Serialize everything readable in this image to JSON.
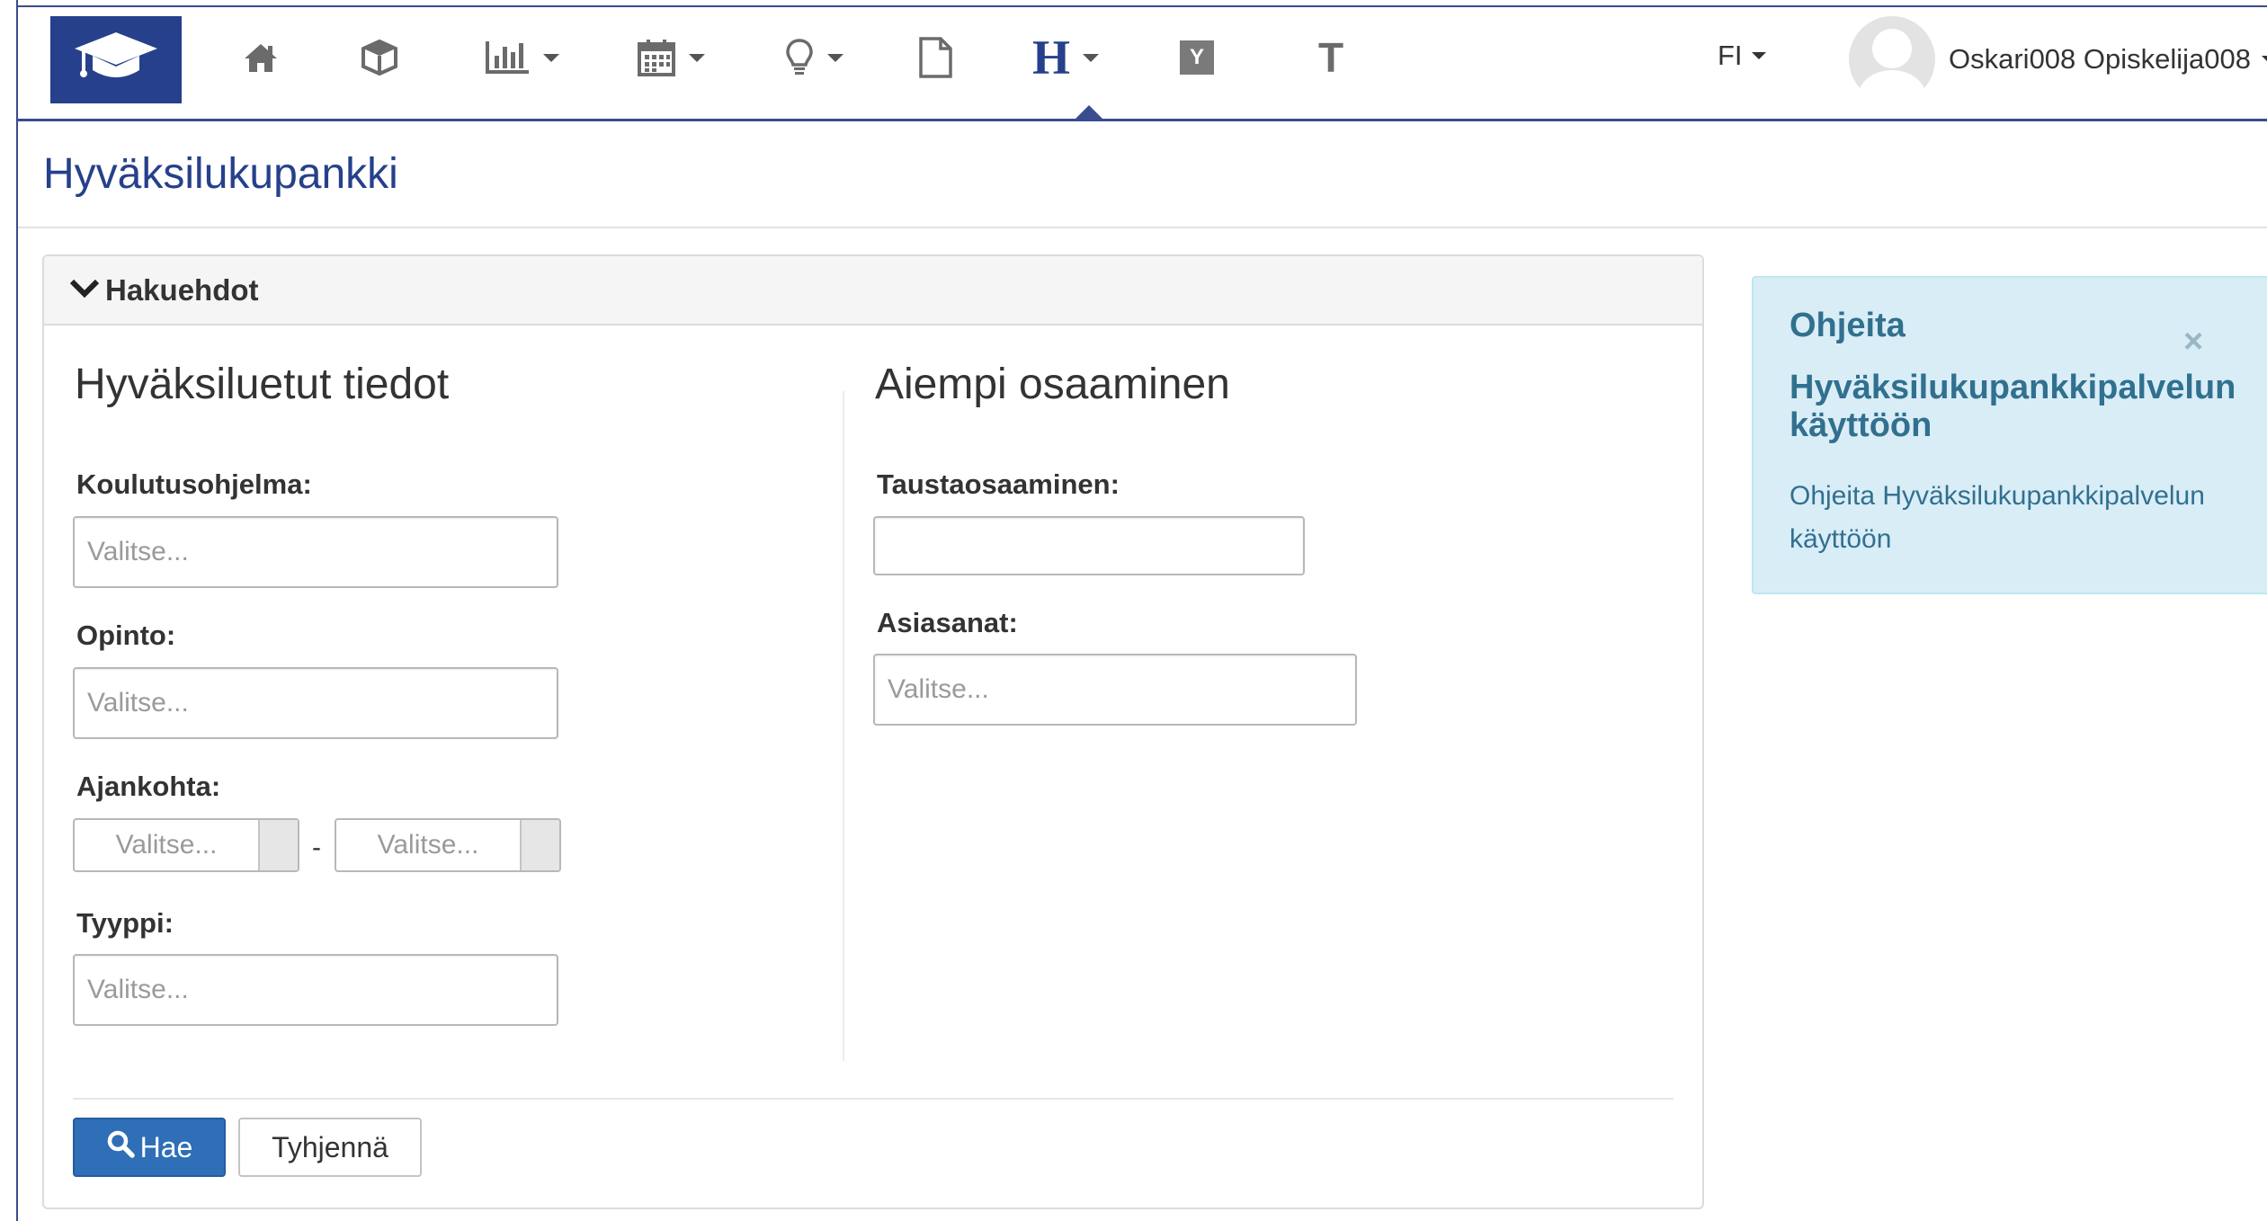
{
  "nav": {
    "icons": [
      "graduation-cap-icon",
      "home-icon",
      "cube-icon",
      "bar-chart-icon",
      "calendar-icon",
      "lightbulb-icon",
      "file-icon",
      "h-letter-icon",
      "y-box-icon",
      "t-letter-icon"
    ],
    "h_label": "H",
    "y_label": "Y",
    "t_label": "T",
    "language": "FI",
    "user_name": "Oskari008 Opiskelija008",
    "accent_color": "#26408b"
  },
  "page": {
    "title": "Hyväksilukupankki"
  },
  "search": {
    "panel_title": "Hakuehdot",
    "left_section_title": "Hyväksiluetut tiedot",
    "right_section_title": "Aiempi osaaminen",
    "fields": {
      "koulutusohjelma": {
        "label": "Koulutusohjelma:",
        "placeholder": "Valitse..."
      },
      "opinto": {
        "label": "Opinto:",
        "placeholder": "Valitse..."
      },
      "ajankohta": {
        "label": "Ajankohta:",
        "from_placeholder": "Valitse...",
        "to_placeholder": "Valitse...",
        "separator": "-"
      },
      "tyyppi": {
        "label": "Tyyppi:",
        "placeholder": "Valitse..."
      },
      "taustaosaaminen": {
        "label": "Taustaosaaminen:",
        "value": ""
      },
      "asiasanat": {
        "label": "Asiasanat:",
        "placeholder": "Valitse..."
      }
    },
    "search_button": "Hae",
    "clear_button": "Tyhjennä",
    "primary_color": "#2e6fb7"
  },
  "help": {
    "heading": "Ohjeita",
    "close_symbol": "×",
    "subheading": "Hyväksilukupankkipalvelun käyttöön",
    "text": "Ohjeita Hyväksilukupankkipalvelun käyttöön",
    "bg_color": "#d9edf7",
    "text_color": "#31708f"
  }
}
